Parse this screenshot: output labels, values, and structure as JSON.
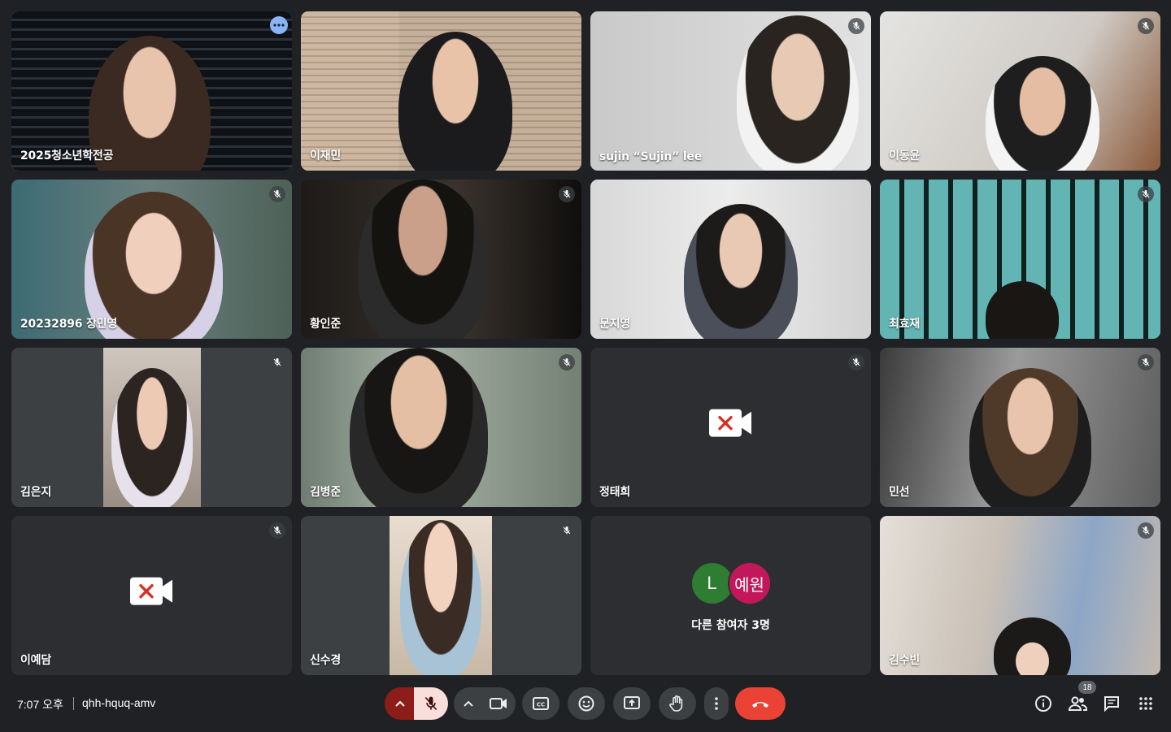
{
  "participants": [
    {
      "name": "2025청소년학전공",
      "speaking": true
    },
    {
      "name": "이재민"
    },
    {
      "name": "sujin “Sujin” lee"
    },
    {
      "name": "이동윤"
    },
    {
      "name": "20232896 장민영"
    },
    {
      "name": "황인준"
    },
    {
      "name": "문지영"
    },
    {
      "name": "최효재"
    },
    {
      "name": "김은지"
    },
    {
      "name": "김병준"
    },
    {
      "name": "정태희",
      "camera": "off"
    },
    {
      "name": "민선"
    },
    {
      "name": "이예담",
      "camera": "off"
    },
    {
      "name": "신수경"
    },
    {
      "name": "김수빈"
    }
  ],
  "others_tile": {
    "avatars": [
      {
        "letter": "L",
        "color": "#2e7d32"
      },
      {
        "letter": "예원",
        "color": "#c2185b"
      }
    ],
    "label": "다른 참여자 3명"
  },
  "bottom_bar": {
    "time": "7:07 오후",
    "meeting_code": "qhh-hquq-amv",
    "people_count": "18",
    "end_call_color": "#ea4335",
    "controls": [
      "mic-options",
      "microphone-muted",
      "camera-options",
      "camera",
      "captions",
      "emoji-reactions",
      "present-screen",
      "raise-hand",
      "more-options",
      "leave-call"
    ],
    "right_icons": [
      "info-icon",
      "people-icon",
      "chat-icon",
      "activities-icon"
    ]
  }
}
